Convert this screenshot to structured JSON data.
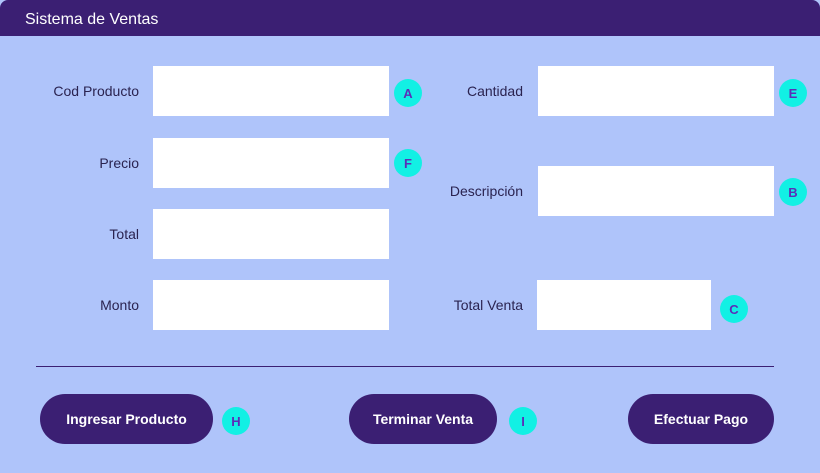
{
  "window": {
    "title": "Sistema de Ventas"
  },
  "form": {
    "cod_producto": {
      "label": "Cod Producto",
      "value": "",
      "badge": "A"
    },
    "precio": {
      "label": "Precio",
      "value": "",
      "badge": "F"
    },
    "total": {
      "label": "Total",
      "value": ""
    },
    "monto": {
      "label": "Monto",
      "value": ""
    },
    "cantidad": {
      "label": "Cantidad",
      "value": "",
      "badge": "E"
    },
    "descripcion": {
      "label": "Descripción",
      "value": "",
      "badge": "B"
    },
    "total_venta": {
      "label": "Total Venta",
      "value": "",
      "badge": "C"
    }
  },
  "actions": {
    "ingresar": {
      "label": "Ingresar Producto",
      "badge": "H"
    },
    "terminar": {
      "label": "Terminar Venta",
      "badge": "I"
    },
    "pagar": {
      "label": "Efectuar Pago"
    }
  },
  "colors": {
    "background": "#afc4fa",
    "titlebar": "#3b1f73",
    "button": "#3b1f73",
    "badge": "#12f0e4",
    "badge_text": "#5b2fb8"
  }
}
